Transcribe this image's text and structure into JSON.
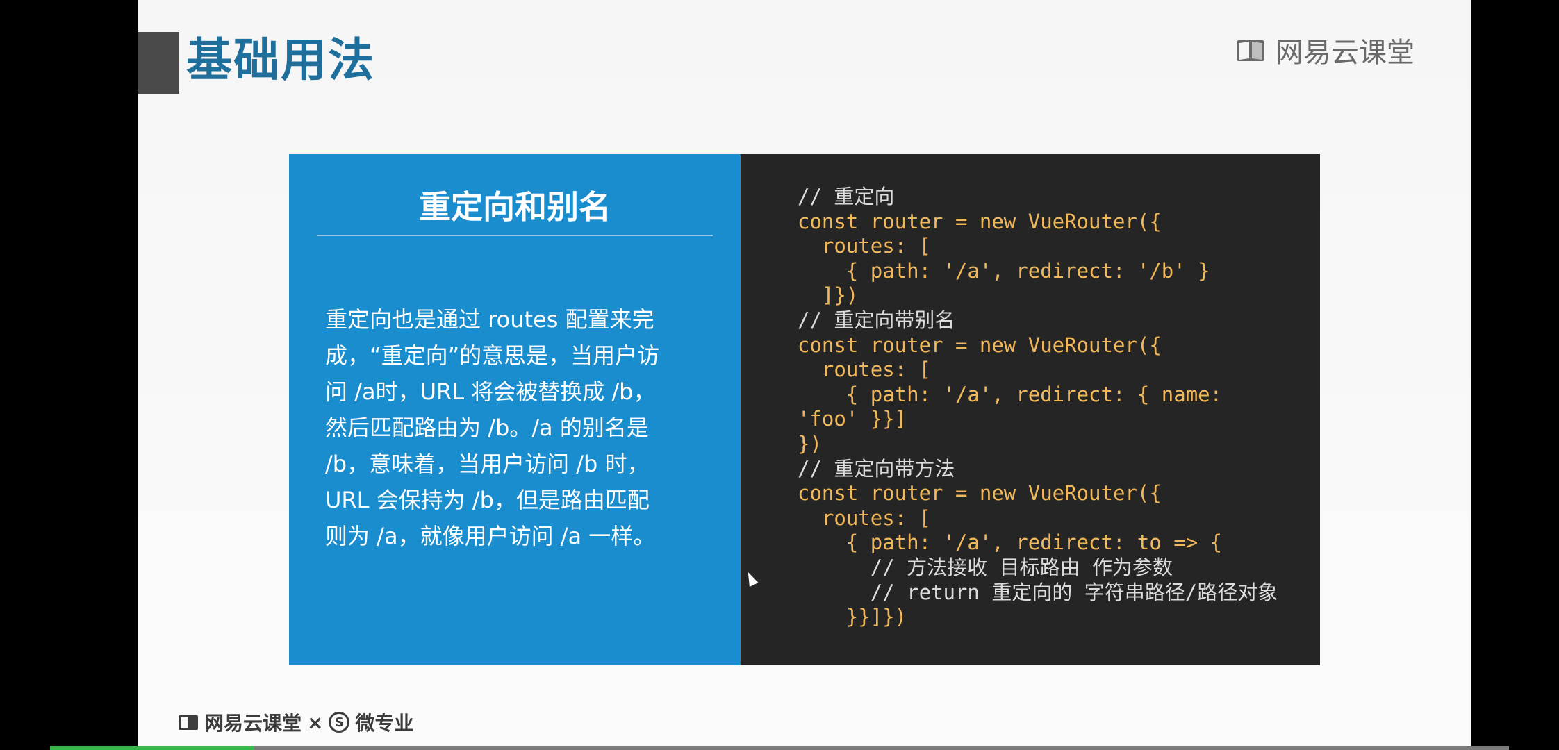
{
  "slide": {
    "title": "基础用法",
    "brand_top": "网易云课堂",
    "brand_bottom": {
      "left": "网易云课堂",
      "separator": "×",
      "badge": "S",
      "right": "微专业"
    }
  },
  "card_left": {
    "heading": "重定向和别名",
    "body_lines": [
      "重定向也是通过 routes 配置来完",
      "成，“重定向”的意思是，当用户访",
      "问 /a时，URL 将会被替换成 /b，",
      "然后匹配路由为 /b。/a 的别名是",
      "/b，意味着，当用户访问 /b 时，",
      "URL 会保持为 /b，但是路由匹配",
      "则为 /a，就像用户访问 /a 一样。"
    ]
  },
  "code_lines": [
    "// 重定向",
    "const router = new VueRouter({",
    "  routes: [",
    "    { path: '/a', redirect: '/b' }",
    "  ]})",
    "// 重定向带别名",
    "const router = new VueRouter({",
    "  routes: [",
    "    { path: '/a', redirect: { name:",
    "'foo' }}]",
    "})",
    "// 重定向带方法",
    "const router = new VueRouter({",
    "  routes: [",
    "    { path: '/a', redirect: to => {",
    "      // 方法接收 目标路由 作为参数",
    "      // return 重定向的 字符串路径/路径对象",
    "    }}]})"
  ],
  "icons": {
    "brand_logo": "book-logo-icon",
    "cursor": "mouse-cursor-icon"
  },
  "colors": {
    "title": "#1e6f9c",
    "card_left_bg": "#1a8dcf",
    "card_right_bg": "#252525",
    "code_text": "#f0b85a",
    "progress": "#3bb54a"
  },
  "video_progress": 0.14
}
